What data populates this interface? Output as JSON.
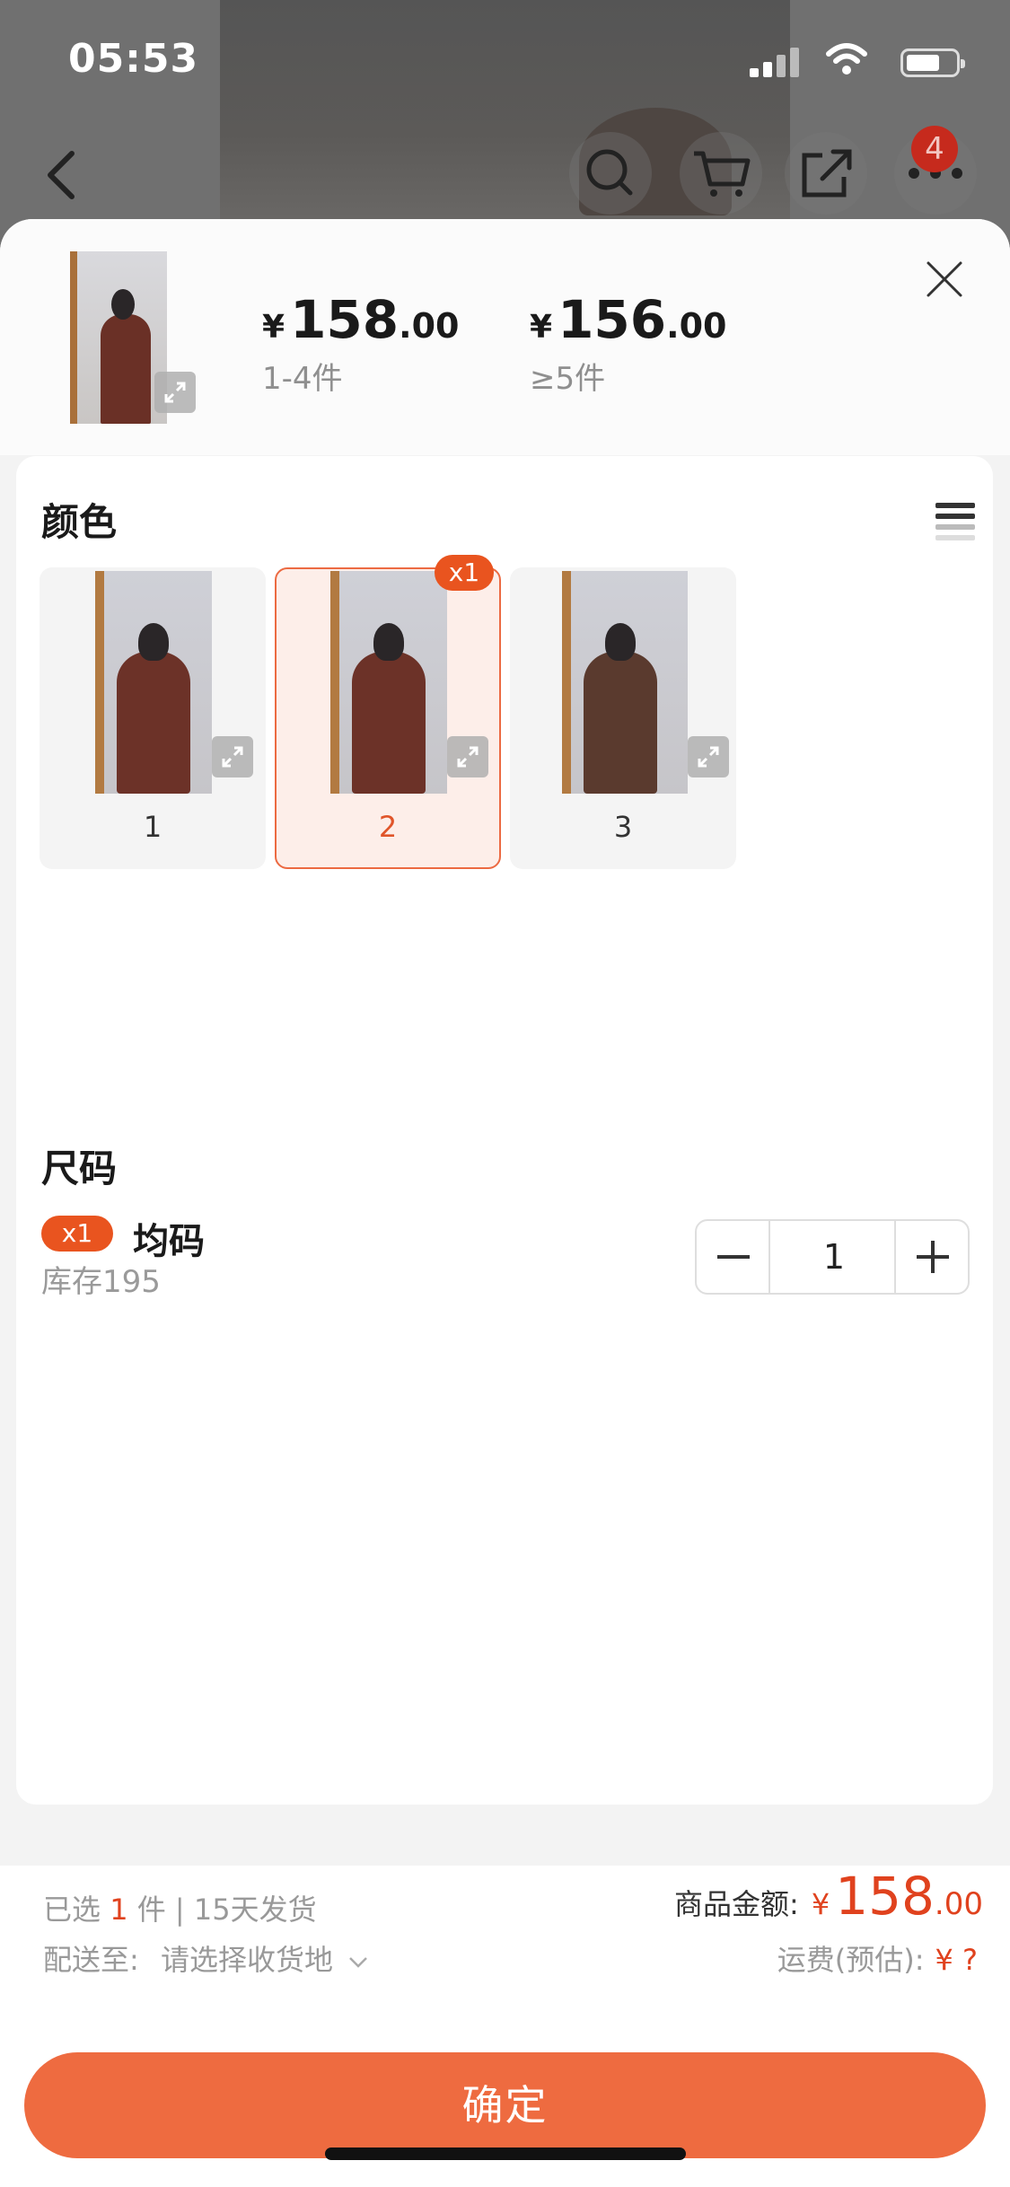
{
  "status_bar": {
    "time": "05:53"
  },
  "nav": {
    "badge_count": "4"
  },
  "header": {
    "tiers": [
      {
        "currency": "¥",
        "int": "158",
        "dec": ".00",
        "range": "1-4件"
      },
      {
        "currency": "¥",
        "int": "156",
        "dec": ".00",
        "range": "≥5件"
      }
    ]
  },
  "color_section": {
    "title": "颜色",
    "options": [
      {
        "label": "1",
        "selected": false
      },
      {
        "label": "2",
        "selected": true,
        "badge": "x1"
      },
      {
        "label": "3",
        "selected": false
      }
    ]
  },
  "size_section": {
    "title": "尺码",
    "badge": "x1",
    "name": "均码",
    "stock": "库存195",
    "quantity": "1"
  },
  "footer": {
    "selected_prefix": "已选",
    "selected_count": "1",
    "selected_suffix": "件 | 15天发货",
    "ship_to_label": "配送至:",
    "ship_to_value": "请选择收货地",
    "amount_label": "商品金额:",
    "amount_currency": "¥",
    "amount_int": "158",
    "amount_dec": ".00",
    "shipping_label": "运费(预估):",
    "shipping_value": "¥ ?",
    "confirm_label": "确定"
  },
  "colors": {
    "accent": "#ee6b40",
    "price_red": "#e0421e",
    "selected_bg": "#fdeee9"
  }
}
